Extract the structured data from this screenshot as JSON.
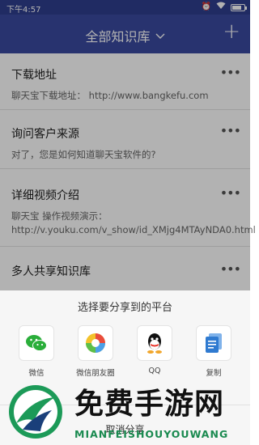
{
  "status_bar": {
    "time": "下午4:57",
    "battery_level": 0.8
  },
  "app_bar": {
    "title": "全部知识库"
  },
  "items": [
    {
      "title": "下载地址",
      "body": "聊天宝下载地址： http://www.bangkefu.com"
    },
    {
      "title": "询问客户来源",
      "body": "对了，您是如何知道聊天宝软件的?"
    },
    {
      "title": "详细视频介绍",
      "body": "聊天宝 操作视频演示： http://v.youku.com/v_show/id_XMjg4MTAyNDA0.html"
    },
    {
      "title": "多人共享知识库",
      "body": ""
    }
  ],
  "share_sheet": {
    "title": "选择要分享到的平台",
    "options": [
      {
        "label": "微信",
        "icon": "wechat-icon",
        "color": "#2aae3a"
      },
      {
        "label": "微信朋友圈",
        "icon": "moments-icon",
        "color": "#f0a020"
      },
      {
        "label": "QQ",
        "icon": "qq-icon",
        "color": "#111111"
      },
      {
        "label": "复制",
        "icon": "copy-icon",
        "color": "#2f7ad0"
      }
    ],
    "cancel": "取消分享"
  },
  "watermark": {
    "brand": "免费手游网",
    "url": "MIANFEISHOUYOUWANG"
  }
}
